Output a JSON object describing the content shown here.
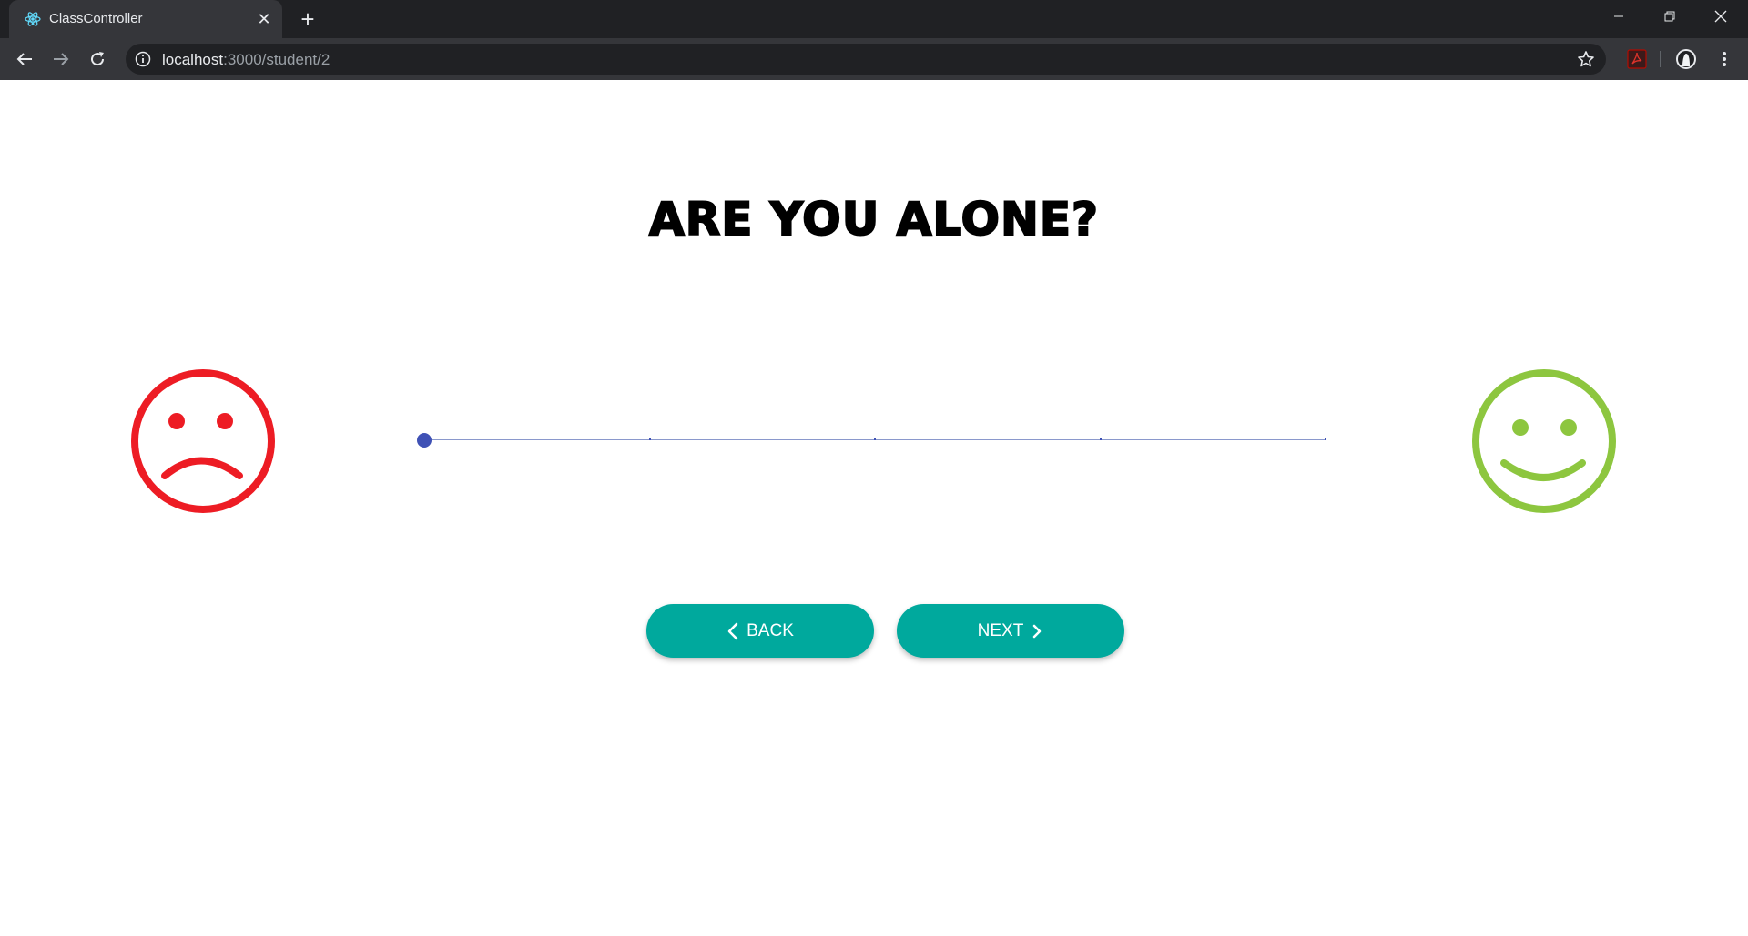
{
  "browser": {
    "tab_title": "ClassController",
    "url_host": "localhost",
    "url_path": ":3000/student/2"
  },
  "page": {
    "question": "ARE YOU ALONE?",
    "back_label": "BACK",
    "next_label": "NEXT",
    "colors": {
      "sad": "#ed1c24",
      "happy": "#8dc63f",
      "button": "#00a99d",
      "slider": "#3f51b5"
    }
  },
  "slider": {
    "min": 1,
    "max": 5,
    "steps": [
      1,
      2,
      3,
      4,
      5
    ],
    "value": 1
  }
}
